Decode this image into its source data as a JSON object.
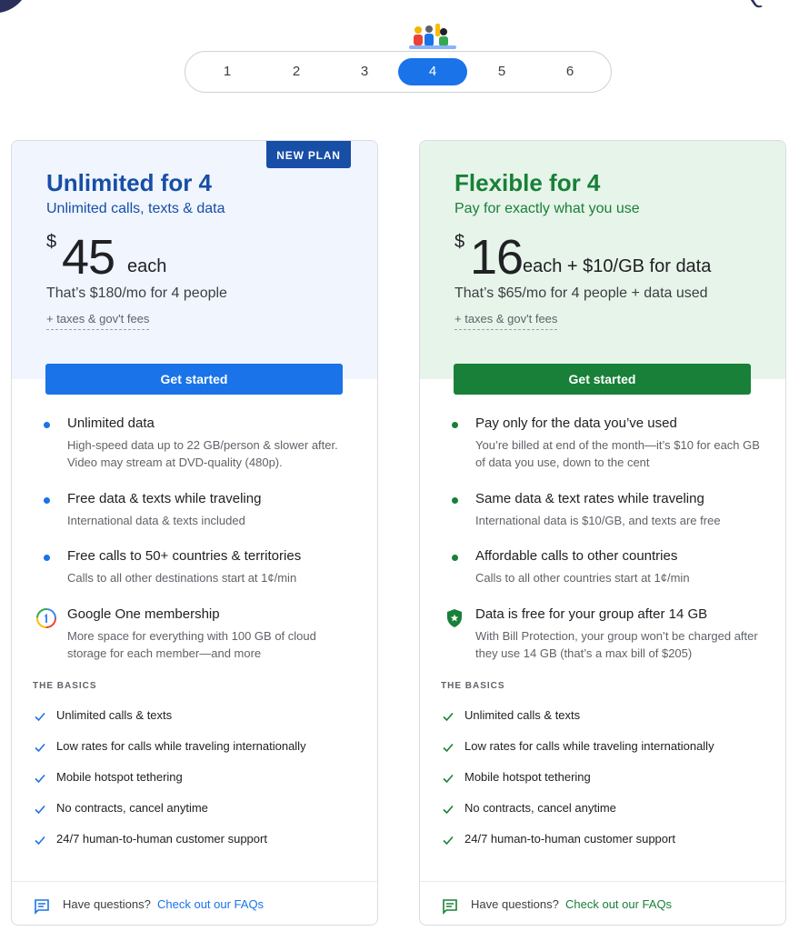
{
  "selector": {
    "options": [
      "1",
      "2",
      "3",
      "4",
      "5",
      "6"
    ],
    "selected": "4"
  },
  "colors": {
    "blue": "#1a73e8",
    "dark_blue": "#174ea6",
    "green": "#188038",
    "blue_bg": "#f0f5fe",
    "green_bg": "#e7f4ea"
  },
  "plans": [
    {
      "badge": "NEW PLAN",
      "title": "Unlimited for 4",
      "subtitle": "Unlimited calls, texts & data",
      "currency": "$",
      "amount": "45",
      "each": "each",
      "per_month": "That’s $180/mo for 4 people",
      "taxes": "+ taxes & gov't fees",
      "cta": "Get started",
      "features": [
        {
          "title": "Unlimited data",
          "desc": "High-speed data up to 22 GB/person & slower after. Video may stream at DVD-quality (480p).",
          "icon": "bullet"
        },
        {
          "title": "Free data & texts while traveling",
          "desc": "International data & texts included",
          "icon": "bullet"
        },
        {
          "title": "Free calls to 50+ countries & territories",
          "desc": "Calls to all other destinations start at 1¢/min",
          "icon": "bullet"
        },
        {
          "title": "Google One membership",
          "desc": "More space for everything with 100 GB of cloud storage for each member—and more",
          "icon": "google-one-icon"
        }
      ],
      "basics_label": "THE BASICS",
      "basics": [
        "Unlimited calls & texts",
        "Low rates for calls while traveling internationally",
        "Mobile hotspot tethering",
        "No contracts, cancel anytime",
        "24/7 human-to-human customer support"
      ],
      "footer_question": "Have questions?",
      "footer_link": "Check out our FAQs"
    },
    {
      "title": "Flexible for 4",
      "subtitle": "Pay for exactly what you use",
      "currency": "$",
      "amount": "16",
      "each": "each + $10/GB for data",
      "per_month": "That’s $65/mo for 4 people + data used",
      "taxes": "+ taxes & gov't fees",
      "cta": "Get started",
      "features": [
        {
          "title": "Pay only for the data you’ve used",
          "desc": "You’re billed at end of the month—it’s $10 for each GB of data you use, down to the cent",
          "icon": "bullet"
        },
        {
          "title": "Same data & text rates while traveling",
          "desc": "International data is $10/GB, and texts are free",
          "icon": "bullet"
        },
        {
          "title": "Affordable calls to other countries",
          "desc": "Calls to all other countries start at 1¢/min",
          "icon": "bullet"
        },
        {
          "title": "Data is free for your group after 14 GB",
          "desc": "With Bill Protection, your group won’t be charged after they use 14 GB (that’s a max bill of $205)",
          "icon": "shield-icon"
        }
      ],
      "basics_label": "THE BASICS",
      "basics": [
        "Unlimited calls & texts",
        "Low rates for calls while traveling internationally",
        "Mobile hotspot tethering",
        "No contracts, cancel anytime",
        "24/7 human-to-human customer support"
      ],
      "footer_question": "Have questions?",
      "footer_link": "Check out our FAQs"
    }
  ]
}
